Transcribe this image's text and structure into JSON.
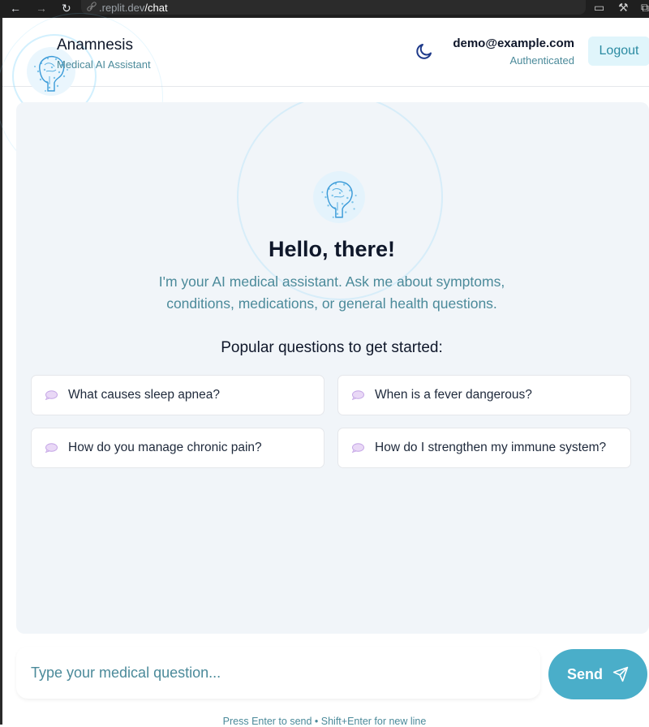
{
  "browser": {
    "url_domain": ".replit.dev",
    "url_path": "/chat"
  },
  "header": {
    "title": "Anamnesis",
    "subtitle": "Medical AI Assistant",
    "theme_icon": "moon-icon",
    "user_email": "demo@example.com",
    "user_status": "Authenticated",
    "logout_label": "Logout"
  },
  "welcome": {
    "greeting": "Hello, there!",
    "intro": "I'm your AI medical assistant. Ask me about symptoms, conditions, medications, or general health questions.",
    "popular_heading": "Popular questions to get started:",
    "questions": [
      "What causes sleep apnea?",
      "When is a fever dangerous?",
      "How do you manage chronic pain?",
      "How do I strengthen my immune system?"
    ]
  },
  "composer": {
    "placeholder": "Type your medical question...",
    "send_label": "Send",
    "hint": "Press Enter to send • Shift+Enter for new line"
  },
  "colors": {
    "accent": "#4aaec9",
    "muted_text": "#4b8a9a",
    "panel_bg": "#f1f5f9"
  }
}
